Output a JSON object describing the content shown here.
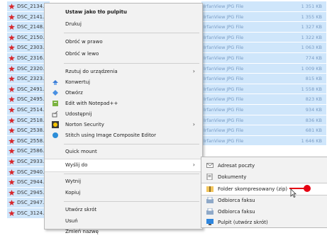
{
  "files": [
    {
      "name": "DSC_2134.jpg",
      "type": "IrfanView JPG File",
      "size": "1 351 KB"
    },
    {
      "name": "DSC_2141.jpg",
      "type": "IrfanView JPG File",
      "size": "1 355 KB"
    },
    {
      "name": "DSC_2148.jpg",
      "type": "IrfanView JPG File",
      "size": "1 327 KB"
    },
    {
      "name": "DSC_2150.jpg",
      "type": "IrfanView JPG File",
      "size": "1 322 KB"
    },
    {
      "name": "DSC_2303.jpg",
      "type": "IrfanView JPG File",
      "size": "1 063 KB"
    },
    {
      "name": "DSC_2316.jpg",
      "type": "IrfanView JPG File",
      "size": "774 KB"
    },
    {
      "name": "DSC_2320.jpg",
      "type": "IrfanView JPG File",
      "size": "1 009 KB"
    },
    {
      "name": "DSC_2323.jpg",
      "type": "IrfanView JPG File",
      "size": "815 KB"
    },
    {
      "name": "DSC_2491.jpg",
      "type": "IrfanView JPG File",
      "size": "1 558 KB"
    },
    {
      "name": "DSC_2495.jpg",
      "type": "IrfanView JPG File",
      "size": "823 KB"
    },
    {
      "name": "DSC_2514.jpg",
      "type": "IrfanView JPG File",
      "size": "934 KB"
    },
    {
      "name": "DSC_2518.jpg",
      "type": "IrfanView JPG File",
      "size": "836 KB"
    },
    {
      "name": "DSC_2538.jpg",
      "type": "IrfanView JPG File",
      "size": "681 KB"
    },
    {
      "name": "DSC_2558.jpg",
      "type": "IrfanView JPG File",
      "size": "1 646 KB"
    },
    {
      "name": "DSC_2586.jpg",
      "type": "",
      "size": ""
    },
    {
      "name": "DSC_2933.jpg",
      "type": "",
      "size": ""
    },
    {
      "name": "DSC_2940.jpg",
      "type": "",
      "size": ""
    },
    {
      "name": "DSC_2944.jpg",
      "type": "",
      "size": ""
    },
    {
      "name": "DSC_2945.jpg",
      "type": "",
      "size": ""
    },
    {
      "name": "DSC_2947.jpg",
      "type": "",
      "size": ""
    },
    {
      "name": "DSC_3124.jpg",
      "type": "",
      "size": ""
    }
  ],
  "menu": {
    "set_wallpaper": "Ustaw jako tło pulpitu",
    "print": "Drukuj",
    "rotate_right": "Obróć w prawo",
    "rotate_left": "Obróć w lewo",
    "cast": "Rzutuj do urządzenia",
    "convert": "Konwertuj",
    "open": "Otwórz",
    "edit_notepad": "Edit with Notepad++",
    "share": "Udostępnij",
    "norton": "Norton Security",
    "stitch": "Stitch using Image Composite Editor",
    "quick_mount": "Quick mount",
    "send_to": "Wyślij do",
    "cut": "Wytnij",
    "copy": "Kopiuj",
    "create_shortcut": "Utwórz skrót",
    "delete": "Usuń",
    "rename": "Zmień nazwę"
  },
  "submenu": {
    "mail": "Adresat poczty",
    "documents": "Dokumenty",
    "zip": "Folder skompresowany (zip)",
    "fax1": "Odbiorca faksu",
    "fax2": "Odbiorca faksu",
    "desktop": "Pulpit (utwórz skrót)"
  },
  "colors": {
    "selection": "#cfe6fb",
    "accent": "#e60012"
  }
}
